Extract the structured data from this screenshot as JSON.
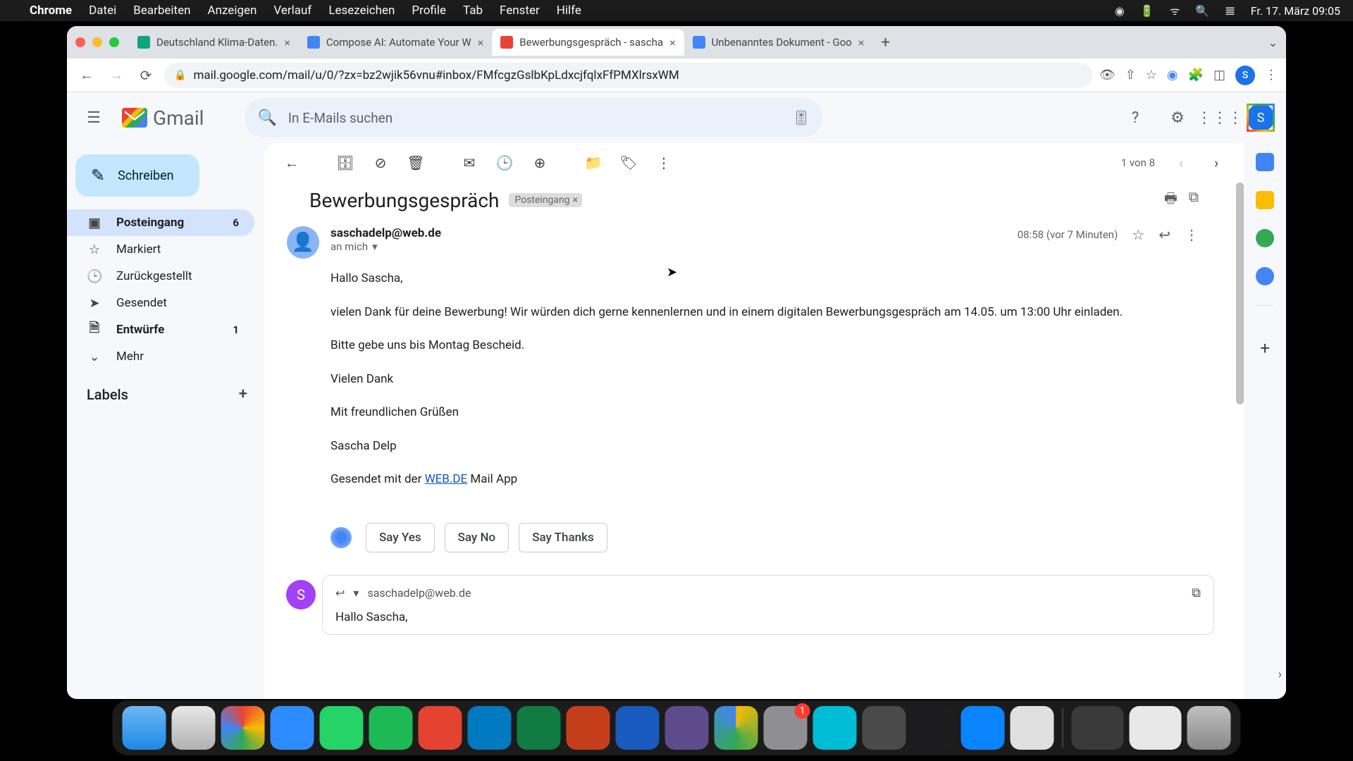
{
  "macos": {
    "app": "Chrome",
    "menu": [
      "Datei",
      "Bearbeiten",
      "Anzeigen",
      "Verlauf",
      "Lesezeichen",
      "Profile",
      "Tab",
      "Fenster",
      "Hilfe"
    ],
    "clock": "Fr. 17. März  09:05"
  },
  "chrome": {
    "tabs": [
      {
        "title": "Deutschland Klima-Daten.",
        "favicon": "#10a37f"
      },
      {
        "title": "Compose AI: Automate Your W",
        "favicon": "#4285f4"
      },
      {
        "title": "Bewerbungsgespräch - sascha",
        "favicon": "#ea4335",
        "active": true
      },
      {
        "title": "Unbenanntes Dokument - Goo",
        "favicon": "#4285f4"
      }
    ],
    "url": "mail.google.com/mail/u/0/?zx=bz2wjik56vnu#inbox/FMfcgzGslbKpLdxcjfqlxFfPMXlrsxWM"
  },
  "gmail": {
    "brand": "Gmail",
    "search_placeholder": "In E-Mails suchen",
    "compose": "Schreiben",
    "nav": {
      "inbox": {
        "label": "Posteingang",
        "count": "6"
      },
      "starred": "Markiert",
      "snoozed": "Zurückgestellt",
      "sent": "Gesendet",
      "drafts": {
        "label": "Entwürfe",
        "count": "1"
      },
      "more": "Mehr"
    },
    "labels_header": "Labels",
    "pagination": "1 von 8",
    "email": {
      "subject": "Bewerbungsgespräch",
      "inbox_chip": "Posteingang",
      "sender": "saschadelp@web.de",
      "recipient": "an mich",
      "time": "08:58 (vor 7 Minuten)",
      "body": {
        "p1": "Hallo Sascha,",
        "p2": "vielen Dank für deine Bewerbung! Wir würden dich gerne kennenlernen und in einem digitalen Bewerbungsgespräch am 14.05. um 13:00 Uhr einladen.",
        "p3": "Bitte gebe uns bis Montag Bescheid.",
        "p4": "Vielen Dank",
        "p5": "Mit freundlichen Grüßen",
        "p6": "Sascha Delp",
        "sent_with_pre": "Gesendet mit der ",
        "sent_with_link": "WEB.DE",
        "sent_with_post": " Mail App"
      }
    },
    "smart_replies": [
      "Say Yes",
      "Say No",
      "Say Thanks"
    ],
    "reply": {
      "to": "saschadelp@web.de",
      "draft": "Hallo Sascha,"
    },
    "avatar_letter": "S"
  },
  "dock_apps": [
    {
      "c": "#b8d0e8"
    },
    {
      "c": "#1e88e5"
    },
    {
      "c": "#ea4335"
    },
    {
      "c": "#2d8cff"
    },
    {
      "c": "#25d366"
    },
    {
      "c": "#1db954"
    },
    {
      "c": "#e44332"
    },
    {
      "c": "#0079bf"
    },
    {
      "c": "#107c41"
    },
    {
      "c": "#c43e1c"
    },
    {
      "c": "#185abd"
    },
    {
      "c": "#7b4fc9"
    },
    {
      "c": "#fbbc04"
    },
    {
      "c": "#8e8e93"
    },
    {
      "c": "#00bcd4"
    },
    {
      "c": "#5ac8fa"
    },
    {
      "c": "#4a4a4a"
    },
    {
      "c": "#0a84ff"
    },
    {
      "c": "#e0e0e0"
    }
  ]
}
